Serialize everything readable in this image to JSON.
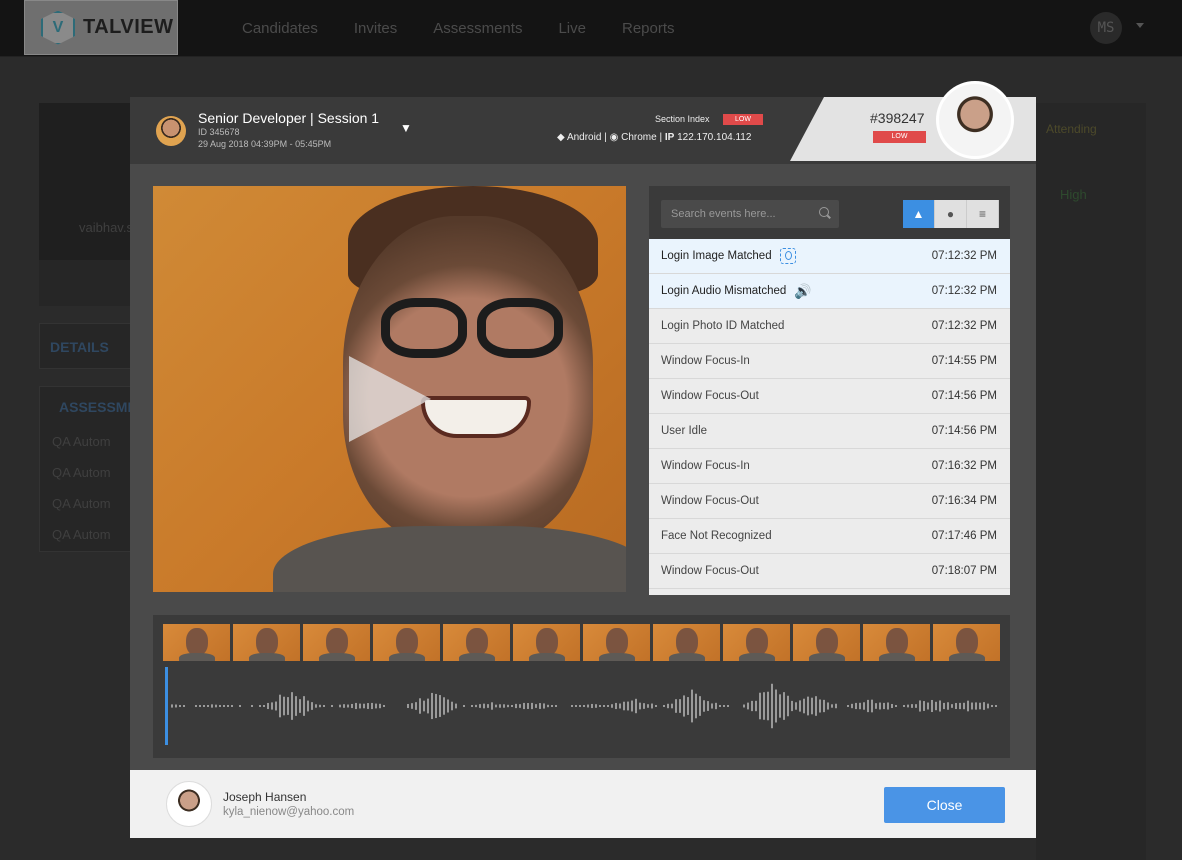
{
  "app": {
    "logo_text": "TALVIEW",
    "logo_mark": "V"
  },
  "nav": {
    "items": [
      "Candidates",
      "Invites",
      "Assessments",
      "Live",
      "Reports"
    ]
  },
  "user": {
    "initials": "MS"
  },
  "background": {
    "profile_name": "vaibhav.s",
    "details_label": "DETAILS",
    "assessments_label": "ASSESSME",
    "rows": [
      "QA Autom",
      "QA Autom",
      "QA Autom",
      "QA Autom"
    ],
    "attending_label": "Attending",
    "high_label": "High"
  },
  "modal": {
    "session_title": "Senior Developer | Session 1",
    "session_id": "ID 345678",
    "session_date": "29 Aug 2018   04:39PM - 05:45PM",
    "section_index_label": "Section Index",
    "section_risk": "LOW",
    "env": {
      "os": "Android",
      "browser": "Chrome",
      "ip_label": "IP",
      "ip": "122.170.104.112"
    },
    "case_id": "#398247",
    "case_risk": "LOW"
  },
  "events": {
    "search_placeholder": "Search events here...",
    "filters": [
      "warning-icon",
      "globe-icon",
      "sliders-icon"
    ],
    "rows": [
      {
        "name": "Login Image Matched",
        "time": "07:12:32 PM",
        "icon": "face-scan-icon",
        "highlight": true
      },
      {
        "name": "Login Audio Mismatched",
        "time": "07:12:32 PM",
        "icon": "speaker-icon",
        "highlight": true
      },
      {
        "name": "Login Photo ID Matched",
        "time": "07:12:32 PM"
      },
      {
        "name": "Window Focus-In",
        "time": "07:14:55 PM"
      },
      {
        "name": "Window Focus-Out",
        "time": "07:14:56 PM"
      },
      {
        "name": "User Idle",
        "time": "07:14:56 PM"
      },
      {
        "name": "Window Focus-In",
        "time": "07:16:32 PM"
      },
      {
        "name": "Window Focus-Out",
        "time": "07:16:34 PM"
      },
      {
        "name": "Face Not Recognized",
        "time": "07:17:46 PM"
      },
      {
        "name": "Window Focus-Out",
        "time": "07:18:07 PM"
      }
    ]
  },
  "timeline": {
    "thumbnail_count": 12
  },
  "candidate": {
    "name": "Joseph Hansen",
    "email": "kyla_nienow@yahoo.com"
  },
  "footer": {
    "close_label": "Close"
  },
  "colors": {
    "accent": "#3c8fe2",
    "danger": "#e04a4a",
    "brand": "#2d6b78"
  }
}
